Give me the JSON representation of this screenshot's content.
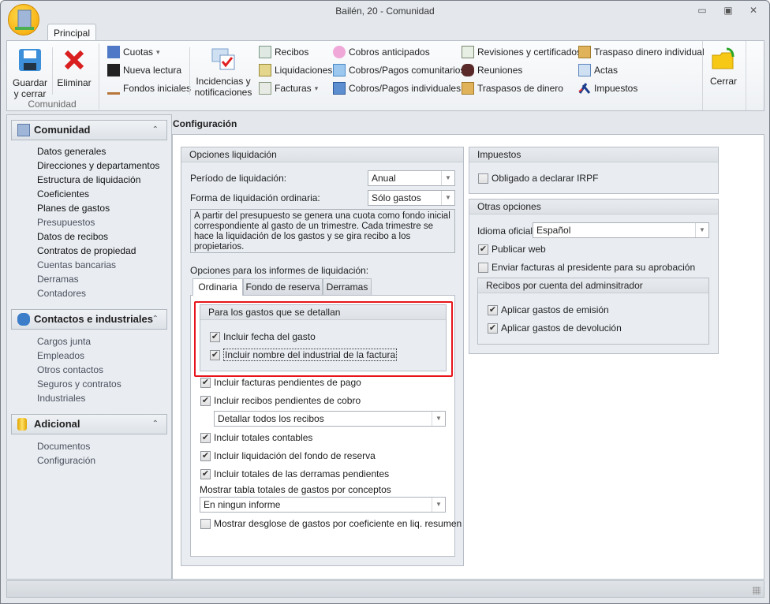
{
  "window": {
    "title": "Bailén, 20 - Comunidad",
    "minimize": "▭",
    "restore": "▣",
    "close": "✕"
  },
  "ribbon": {
    "tab": "Principal",
    "group_label": "Comunidad",
    "guardar": "Guardar y cerrar",
    "eliminar": "Eliminar",
    "cuotas": "Cuotas",
    "nueva_lectura": "Nueva lectura",
    "fondos": "Fondos iniciales",
    "incidencias": "Incidencias y notificaciones",
    "recibos": "Recibos",
    "liquidaciones": "Liquidaciones",
    "facturas": "Facturas",
    "cobros_anticipados": "Cobros anticipados",
    "cobros_comunitarios": "Cobros/Pagos comunitarios",
    "cobros_individuales": "Cobros/Pagos individuales",
    "revisiones": "Revisiones y certificados",
    "reuniones": "Reuniones",
    "traspasos": "Traspasos de dinero",
    "traspaso_individual": "Traspaso dinero individual",
    "actas": "Actas",
    "impuestos": "Impuestos",
    "cerrar": "Cerrar",
    "dropdown_arrow": "▾"
  },
  "sidebar": {
    "sections": [
      {
        "title": "Comunidad",
        "items": [
          {
            "label": "Datos generales"
          },
          {
            "label": "Direcciones y departamentos"
          },
          {
            "label": "Estructura de liquidación"
          },
          {
            "label": "Coeficientes"
          },
          {
            "label": "Planes de gastos"
          },
          {
            "label": "Presupuestos"
          },
          {
            "label": "Datos de recibos"
          },
          {
            "label": "Contratos de propiedad"
          },
          {
            "label": "Cuentas bancarias"
          },
          {
            "label": "Derramas"
          },
          {
            "label": "Contadores"
          }
        ]
      },
      {
        "title": "Contactos e industriales",
        "items": [
          {
            "label": "Cargos junta"
          },
          {
            "label": "Empleados"
          },
          {
            "label": "Otros contactos"
          },
          {
            "label": "Seguros y contratos"
          },
          {
            "label": "Industriales"
          }
        ]
      },
      {
        "title": "Adicional",
        "items": [
          {
            "label": "Documentos"
          },
          {
            "label": "Configuración"
          }
        ]
      }
    ],
    "collapse": "⌃"
  },
  "main": {
    "title": "Configuración",
    "liquidacion": {
      "title": "Opciones liquidación",
      "periodo_label": "Período de liquidación:",
      "periodo_value": "Anual",
      "forma_label": "Forma de liquidación ordinaria:",
      "forma_value": "Sólo gastos",
      "description": "A partir del presupuesto se genera una cuota como fondo inicial correspondiente al gasto de un trimestre. Cada trimestre se hace la liquidación de los gastos y se gira recibo a los propietarios.",
      "informes_label": "Opciones para los informes de liquidación:",
      "tabs": [
        "Ordinaria",
        "Fondo de reserva",
        "Derramas"
      ],
      "detalle_group": "Para los gastos que se detallan",
      "fecha_gasto": "Incluir fecha del gasto",
      "nombre_industrial": "Incluir nombre del industrial de la factura",
      "facturas_pendientes": "Incluir facturas pendientes de pago",
      "recibos_pendientes": "Incluir recibos pendientes de cobro",
      "recibos_combo": "Detallar todos los recibos",
      "totales_contables": "Incluir totales contables",
      "fondo_reserva": "Incluir liquidación del fondo de reserva",
      "derramas_pendientes": "Incluir totales de las derramas pendientes",
      "tabla_label": "Mostrar tabla totales de gastos por conceptos",
      "tabla_combo": "En ningun informe",
      "desglose": "Mostrar desglose de gastos por coeficiente en liq. resumen"
    },
    "impuestos": {
      "title": "Impuestos",
      "irpf": "Obligado a declarar IRPF"
    },
    "otras": {
      "title": "Otras opciones",
      "idioma_label": "Idioma oficial:",
      "idioma_value": "Español",
      "publicar": "Publicar web",
      "enviar": "Enviar facturas al presidente para su aprobación",
      "recibos_group": "Recibos por cuenta del adminsitrador",
      "emision": "Aplicar gastos de emisión",
      "devolucion": "Aplicar gastos de devolución"
    },
    "check": "✔",
    "combo_arrow": "▼"
  },
  "colors": {
    "highlight": "#e8141b",
    "accent": "#f5a400"
  }
}
